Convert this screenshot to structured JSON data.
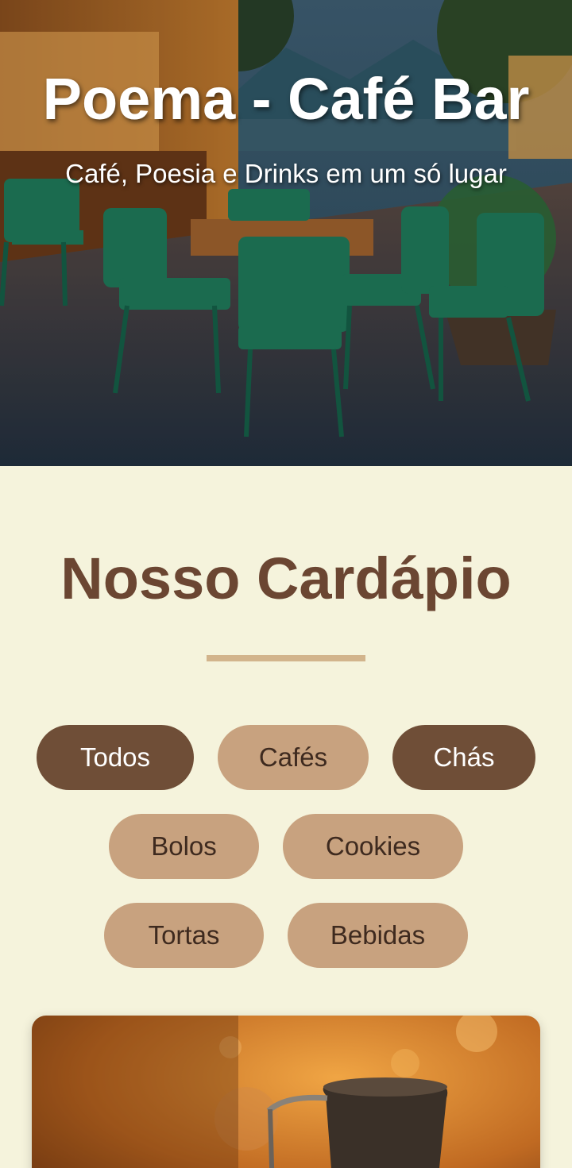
{
  "hero": {
    "title": "Poema - Café Bar",
    "subtitle": "Café, Poesia e Drinks em um só lugar"
  },
  "menu": {
    "title": "Nosso Cardápio",
    "filters": [
      {
        "label": "Todos",
        "active": true
      },
      {
        "label": "Cafés",
        "active": false
      },
      {
        "label": "Chás",
        "active": true
      },
      {
        "label": "Bolos",
        "active": false
      },
      {
        "label": "Cookies",
        "active": false
      },
      {
        "label": "Tortas",
        "active": false
      },
      {
        "label": "Bebidas",
        "active": false
      }
    ]
  },
  "colors": {
    "background": "#F5F3DC",
    "primary_brown": "#6F4E37",
    "light_brown": "#C8A27F",
    "title_brown": "#6B4632",
    "divider": "#D2B48C"
  }
}
